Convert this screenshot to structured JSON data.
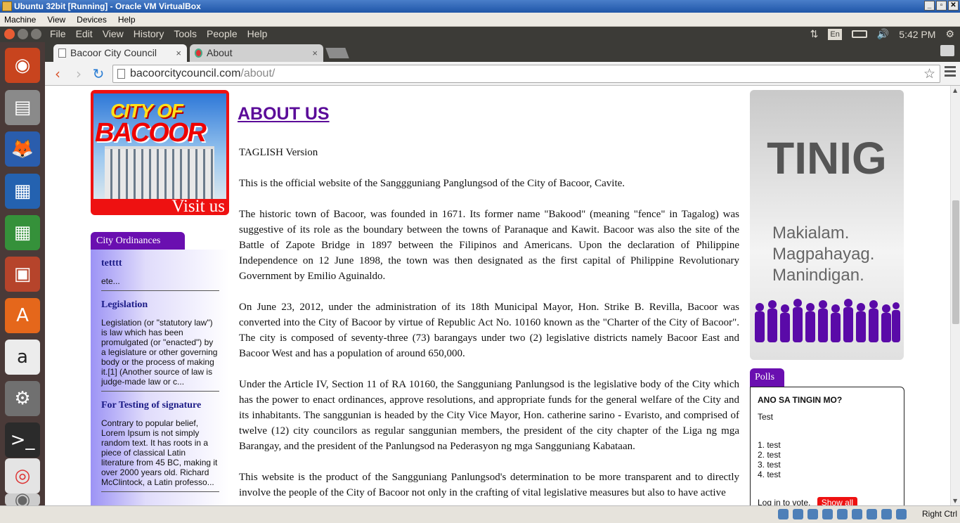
{
  "vbox": {
    "title": "Ubuntu 32bit [Running] - Oracle VM VirtualBox",
    "menu": [
      "Machine",
      "View",
      "Devices",
      "Help"
    ],
    "host_key": "Right Ctrl"
  },
  "ubuntu_panel": {
    "menus": [
      "File",
      "Edit",
      "View",
      "History",
      "Tools",
      "People",
      "Help"
    ],
    "keyboard": "En",
    "clock": "5:42 PM"
  },
  "launcher": [
    "ubuntu-dash-icon",
    "files-icon",
    "firefox-icon",
    "writer-icon",
    "calc-icon",
    "impress-icon",
    "software-center-icon",
    "amazon-icon",
    "settings-icon",
    "terminal-icon",
    "chrome-icon",
    "disc-icon"
  ],
  "browser": {
    "tabs": [
      {
        "label": "Bacoor City Council",
        "close": "×"
      },
      {
        "label": "About",
        "close": "×"
      }
    ],
    "url_host": "bacoorcitycouncil.com",
    "url_path": "/about/"
  },
  "banner": {
    "city_of": "CITY OF",
    "bacoor": "BACOOR",
    "visit": "Visit us"
  },
  "ordinances": {
    "tab": "City Ordinances",
    "items": [
      {
        "title": "tetttt",
        "body": "ete..."
      },
      {
        "title": "Legislation",
        "body": "Legislation (or \"statutory law\") is law which has been promulgated (or \"enacted\") by a legislature or other governing body or the process of making it.[1] (Another source of law is judge-made law or c..."
      },
      {
        "title": "For Testing of signature",
        "body": "Contrary to popular belief, Lorem Ipsum is not simply random text. It has roots in a piece of classical Latin literature from 45 BC, making it over 2000 years old. Richard McClintock, a Latin professo..."
      }
    ]
  },
  "article": {
    "heading": "ABOUT US",
    "paragraphs": [
      "TAGLISH Version",
      "This is the official website of the Sanggguniang Panglungsod of the City of Bacoor, Cavite.",
      "The historic town of Bacoor, was founded in 1671. Its former name \"Bakood\" (meaning \"fence\" in Tagalog) was suggestive of its role as the boundary between the towns of Paranaque and Kawit. Bacoor was also the site of the Battle of Zapote Bridge in 1897 between the Filipinos and Americans. Upon the declaration of Philippine Independence on 12 June 1898, the town was then designated as the first capital of Philippine Revolutionary Government by Emilio Aguinaldo.",
      "On June 23, 2012, under the administration of its 18th Municipal Mayor, Hon. Strike B. Revilla, Bacoor was converted into the City of Bacoor by virtue of Republic Act No. 10160 known as the \"Charter of the City of Bacoor\". The city is composed of seventy-three (73) barangays under two (2) legislative districts namely Bacoor East and Bacoor West and has a population of around 650,000.",
      "Under the Article IV, Section 11 of RA 10160, the Sangguniang Panlungsod is the legislative body of the City which has the power to enact ordinances, approve resolutions, and appropriate funds for the general welfare of the City and its inhabitants. The sanggunian is headed by the City Vice Mayor, Hon. catherine sarino - Evaristo, and comprised of twelve (12) city councilors as regular sanggunian members, the president of the city chapter of the Liga ng mga Barangay, and the president of the Panlungsod na Pederasyon ng mga Sangguniang Kabataan.",
      "This website is the product of the Sangguniang Panlungsod's determination to be more transparent and to directly involve the people of the City of Bacoor not only in the crafting of vital legislative measures but also to have active"
    ]
  },
  "tinig": {
    "title": "TINIG",
    "lines": [
      "Makialam.",
      "Magpahayag.",
      "Manindigan."
    ]
  },
  "polls": {
    "tab": "Polls",
    "question": "ANO SA TINGIN MO?",
    "description": "Test",
    "options": [
      "1. test",
      "2. test",
      "3. test",
      "4. test"
    ],
    "login": "Log in to vote.",
    "show_all": "Show all"
  },
  "colors": {
    "accent_purple": "#6a0fb0",
    "heading_purple": "#5b0c99",
    "show_all_red": "#ee1111"
  }
}
